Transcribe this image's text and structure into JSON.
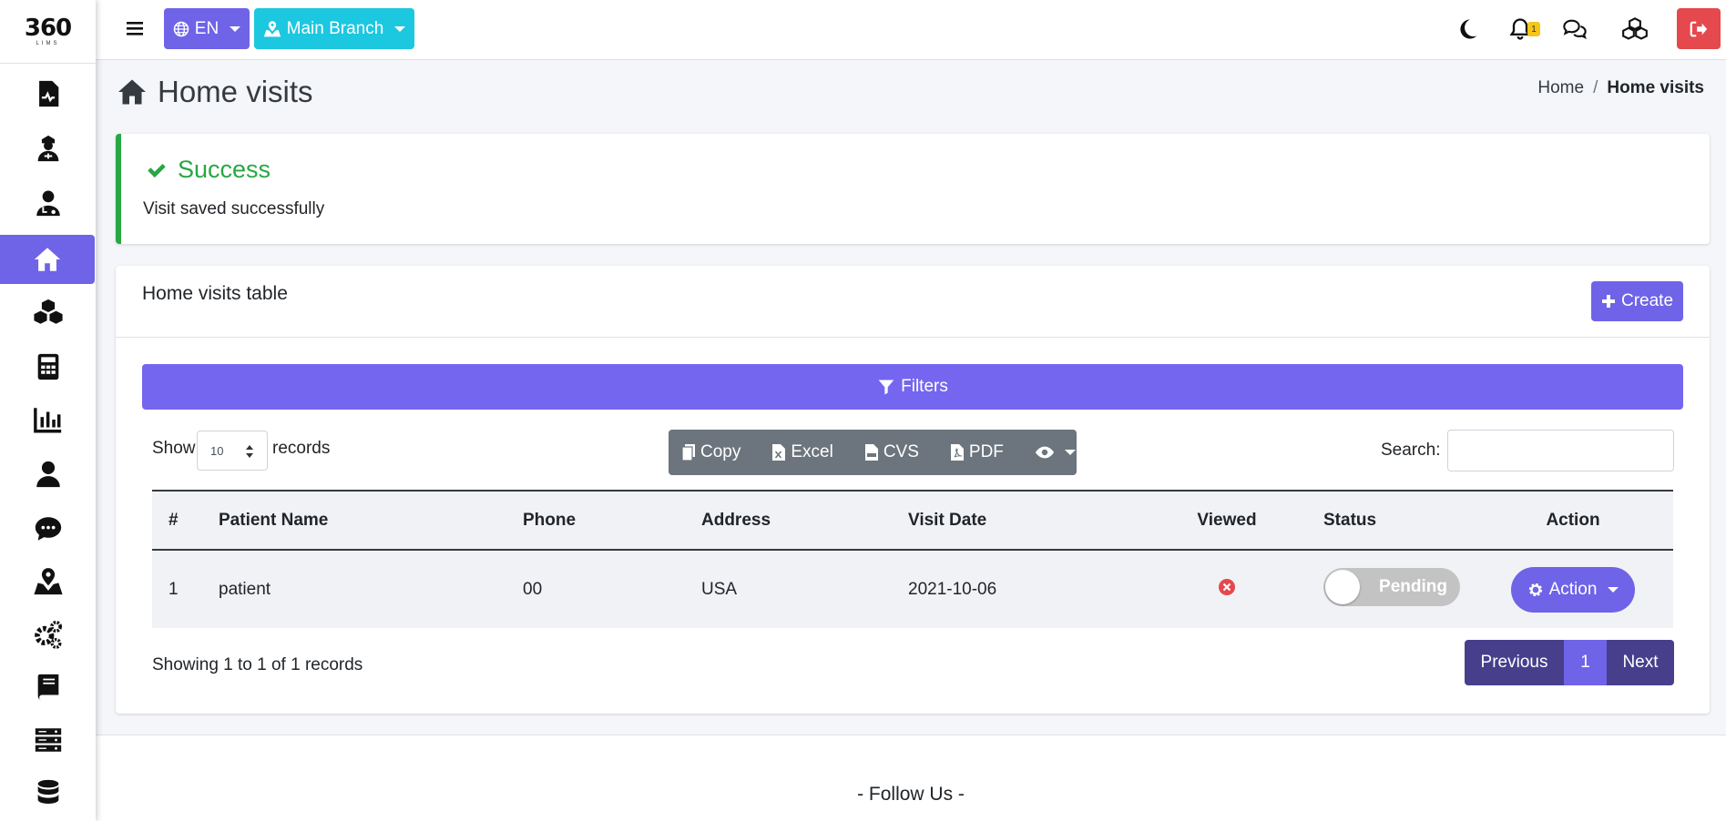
{
  "sidebar": {
    "logo_text": "360",
    "logo_sub": "LIMS",
    "items": [
      {
        "icon": "file-medical-icon"
      },
      {
        "icon": "user-nurse-icon"
      },
      {
        "icon": "user-doctor-icon"
      },
      {
        "icon": "home-icon",
        "active": true
      },
      {
        "icon": "cubes-icon"
      },
      {
        "icon": "calculator-icon"
      },
      {
        "icon": "chart-bar-icon"
      },
      {
        "icon": "user-icon"
      },
      {
        "icon": "comment-dots-icon"
      },
      {
        "icon": "map-marked-icon"
      },
      {
        "icon": "cogs-icon"
      },
      {
        "icon": "book-icon"
      },
      {
        "icon": "server-icon"
      },
      {
        "icon": "database-icon"
      }
    ]
  },
  "topbar": {
    "language": "EN",
    "branch": "Main Branch",
    "notifications_count": "1"
  },
  "page": {
    "title": "Home visits",
    "breadcrumb": {
      "home": "Home",
      "separator": "/",
      "current": "Home visits"
    }
  },
  "alert": {
    "title": "Success",
    "message": "Visit saved successfully"
  },
  "card": {
    "title": "Home visits table",
    "create_label": "Create",
    "filters_label": "Filters",
    "show_label": "Show",
    "page_length": "10",
    "records_label": "records",
    "export_buttons": {
      "copy": "Copy",
      "excel": "Excel",
      "csv": "CVS",
      "pdf": "PDF"
    },
    "search_label": "Search:",
    "search_value": ""
  },
  "table": {
    "columns": [
      "#",
      "Patient Name",
      "Phone",
      "Address",
      "Visit Date",
      "Viewed",
      "Status",
      "Action"
    ],
    "rows": [
      {
        "num": "1",
        "patient_name": "patient",
        "phone": "00",
        "address": "USA",
        "visit_date": "2021-10-06",
        "viewed": false,
        "status": "Pending",
        "action_label": "Action"
      }
    ],
    "info": "Showing 1 to 1 of 1 records",
    "pagination": {
      "previous": "Previous",
      "current": "1",
      "next": "Next"
    }
  },
  "footer": {
    "follow_label": "- Follow Us -"
  },
  "colors": {
    "primary": "#6f63e8",
    "info": "#1cc7e0",
    "success": "#28a745",
    "danger": "#e5484d",
    "export_bg": "#6c757d",
    "pagination_bg": "#473f8c"
  }
}
